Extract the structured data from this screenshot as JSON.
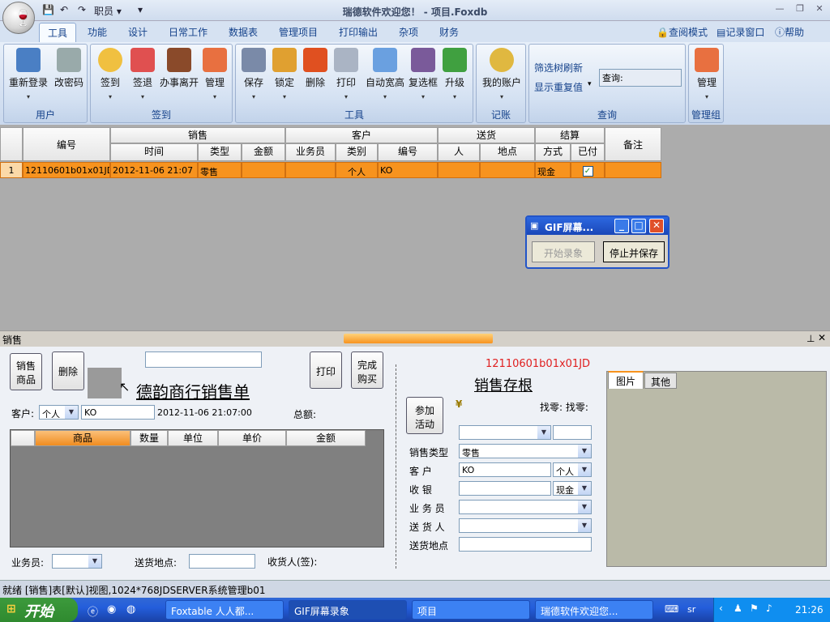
{
  "titlebar": {
    "title": "瑞德软件欢迎您！ - 项目.Foxdb",
    "qat_label": "职员 ▾"
  },
  "tabs": [
    "工具",
    "功能",
    "设计",
    "日常工作",
    "数据表",
    "管理项目",
    "打印输出",
    "杂项",
    "财务"
  ],
  "tab_right": {
    "view": "查阅模式",
    "log": "记录窗口",
    "help": "帮助"
  },
  "ribbon": {
    "groups": [
      {
        "label": "用户",
        "buttons": [
          "重新登录",
          "改密码"
        ]
      },
      {
        "label": "签到",
        "buttons": [
          "签到",
          "签退",
          "办事离开",
          "管理"
        ]
      },
      {
        "label": "工具",
        "buttons": [
          "保存",
          "锁定",
          "删除",
          "打印",
          "自动宽高",
          "复选框",
          "升级"
        ]
      },
      {
        "label": "记账",
        "buttons": [
          "我的账户"
        ]
      },
      {
        "label": "查询",
        "filter_refresh": "筛选树刷新",
        "show_dup": "显示重复值",
        "query_label": "查询:"
      },
      {
        "label": "管理组",
        "buttons": [
          "管理"
        ]
      }
    ]
  },
  "grid": {
    "groups": [
      "销售",
      "客户",
      "送货",
      "结算"
    ],
    "headers": {
      "id": "编号",
      "time": "时间",
      "type": "类型",
      "amount": "金额",
      "salesman": "业务员",
      "category": "类别",
      "cust_no": "编号",
      "person": "人",
      "place": "地点",
      "method": "方式",
      "paid": "已付",
      "note": "备注"
    },
    "row": {
      "index": "1",
      "id": "12110601b01x01JD",
      "time": "2012-11-06 21:07",
      "type": "零售",
      "amount": "",
      "salesman": "",
      "category": "个人",
      "cust_no": "KO",
      "person": "",
      "place": "",
      "method": "现金",
      "paid": "✓",
      "note": ""
    }
  },
  "gif_dialog": {
    "title": "GIF屏幕...",
    "start": "开始录象",
    "stop": "停止并保存"
  },
  "panel": {
    "title": "销售",
    "btn_goods": "销售\n商品",
    "btn_delete": "删除",
    "btn_print": "打印",
    "btn_finish": "完成\n购买",
    "heading": "德韵商行销售单",
    "customer_label": "客户:",
    "customer_type": "个人",
    "customer_code": "KO",
    "datetime": "2012-11-06 21:07:00",
    "total_label": "总额:",
    "table_headers": [
      "商品",
      "数量",
      "单位",
      "单价",
      "金额"
    ],
    "salesman_label": "业务员:",
    "delivery_label": "送货地点:",
    "receiver_label": "收货人(签):",
    "receipt_no": "12110601b01x01JD",
    "stub_title": "销售存根",
    "yen": "¥",
    "change_label": "找零: 找零:",
    "btn_event": "参加\n活动",
    "fields": [
      {
        "label": "销售类型",
        "value": "零售"
      },
      {
        "label": "客    户",
        "value": "KO",
        "extra": "个人"
      },
      {
        "label": "收    银",
        "value": "",
        "extra": "现金"
      },
      {
        "label": "业 务 员",
        "value": ""
      },
      {
        "label": "送 货 人",
        "value": ""
      },
      {
        "label": "送货地点",
        "value": ""
      }
    ],
    "right_tabs": [
      "图片",
      "其他"
    ]
  },
  "status": "就绪 [销售]表[默认]视图,1024*768JDSERVER系统管理b01",
  "taskbar": {
    "start": "开始",
    "tasks": [
      "Foxtable 人人都...",
      "GIF屏幕录象",
      "项目",
      "瑞德软件欢迎您..."
    ],
    "ime": "sr",
    "clock": "21:26"
  }
}
